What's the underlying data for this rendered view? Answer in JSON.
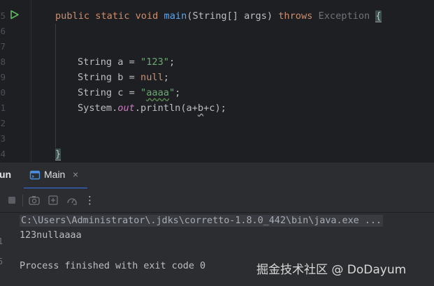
{
  "editor": {
    "gutter": {
      "numbers": [
        "5",
        "6",
        "7",
        "8",
        "9",
        "0",
        "1",
        "2",
        "3",
        "4"
      ],
      "run_gutter_icon": "run-triangle-icon"
    },
    "signature": {
      "mod_public": "public",
      "mod_static": "static",
      "ret_void": "void",
      "method_name": "main",
      "params_type": "(String[] args) ",
      "throws_kw": "throws",
      "exception": "Exception",
      "open_brace": "{"
    },
    "line_a": {
      "decl": "String a = ",
      "value": "\"123\"",
      "end": ";"
    },
    "line_b": {
      "decl": "String b = ",
      "value": "null",
      "end": ";"
    },
    "line_c": {
      "decl": "String c = ",
      "q1": "\"",
      "value": "aaaa",
      "q2": "\"",
      "end": ";"
    },
    "line_print": {
      "sys": "System.",
      "out": "out",
      "call": ".println(a+",
      "b": "b",
      "rest": "+c);"
    },
    "close_brace": "}"
  },
  "run_window": {
    "title": "un",
    "tab": {
      "label": "Main",
      "close": "×",
      "icon": "run-config-icon"
    },
    "actions": [
      "stop-icon",
      "screenshot-icon",
      "restore-layout-icon",
      "profiler-icon",
      "more-options-icon"
    ],
    "more_label": "⋮"
  },
  "console": {
    "command": "C:\\Users\\Administrator\\.jdks\\corretto-1.8.0_442\\bin\\java.exe ...",
    "output": "123nullaaaa",
    "exit": "Process finished with exit code 0",
    "gutter_marks": [
      "1",
      "5"
    ]
  },
  "watermark": "掘金技术社区 @ DoDayum",
  "colors": {
    "editor_bg": "#1e1f22",
    "panel_bg": "#2b2d30",
    "keyword": "#cf8e6d",
    "method": "#56a8f5",
    "string": "#6aab73",
    "static_field": "#c77dbb",
    "accent": "#3574f0"
  }
}
